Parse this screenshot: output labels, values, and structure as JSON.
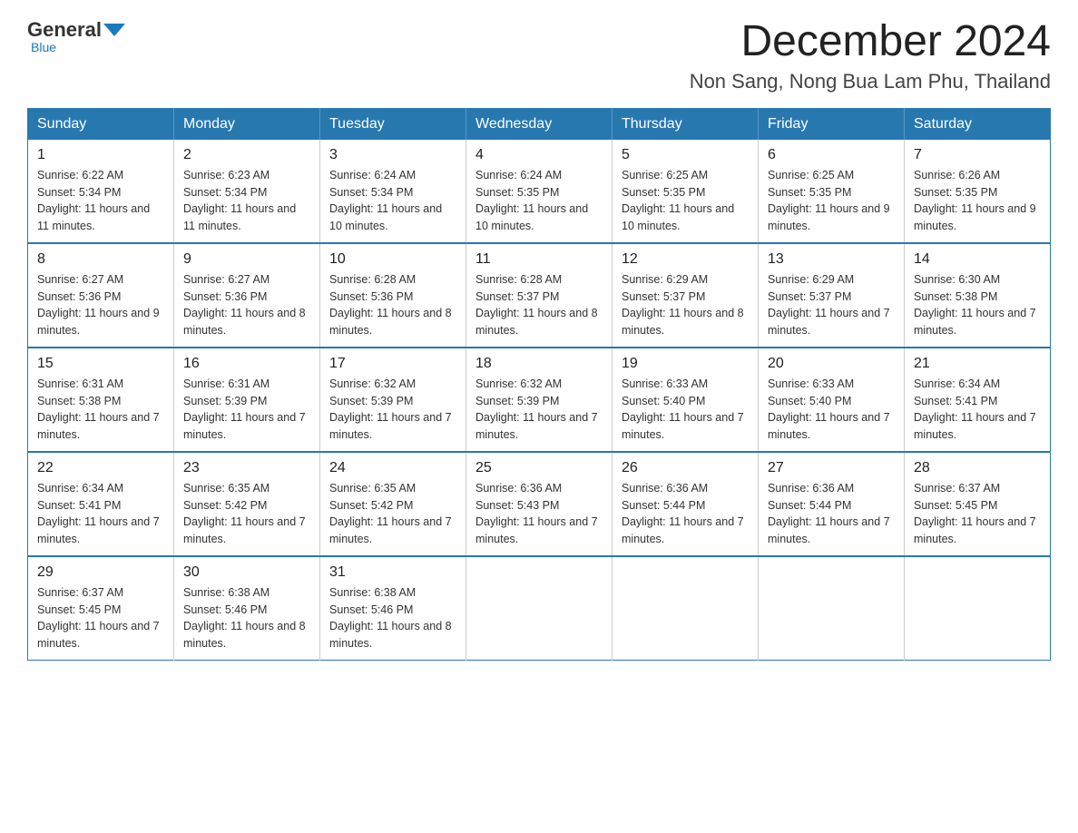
{
  "logo": {
    "general": "General",
    "blue": "Blue"
  },
  "title": "December 2024",
  "location": "Non Sang, Nong Bua Lam Phu, Thailand",
  "days_of_week": [
    "Sunday",
    "Monday",
    "Tuesday",
    "Wednesday",
    "Thursday",
    "Friday",
    "Saturday"
  ],
  "weeks": [
    [
      {
        "day": "1",
        "sunrise": "6:22 AM",
        "sunset": "5:34 PM",
        "daylight": "11 hours and 11 minutes."
      },
      {
        "day": "2",
        "sunrise": "6:23 AM",
        "sunset": "5:34 PM",
        "daylight": "11 hours and 11 minutes."
      },
      {
        "day": "3",
        "sunrise": "6:24 AM",
        "sunset": "5:34 PM",
        "daylight": "11 hours and 10 minutes."
      },
      {
        "day": "4",
        "sunrise": "6:24 AM",
        "sunset": "5:35 PM",
        "daylight": "11 hours and 10 minutes."
      },
      {
        "day": "5",
        "sunrise": "6:25 AM",
        "sunset": "5:35 PM",
        "daylight": "11 hours and 10 minutes."
      },
      {
        "day": "6",
        "sunrise": "6:25 AM",
        "sunset": "5:35 PM",
        "daylight": "11 hours and 9 minutes."
      },
      {
        "day": "7",
        "sunrise": "6:26 AM",
        "sunset": "5:35 PM",
        "daylight": "11 hours and 9 minutes."
      }
    ],
    [
      {
        "day": "8",
        "sunrise": "6:27 AM",
        "sunset": "5:36 PM",
        "daylight": "11 hours and 9 minutes."
      },
      {
        "day": "9",
        "sunrise": "6:27 AM",
        "sunset": "5:36 PM",
        "daylight": "11 hours and 8 minutes."
      },
      {
        "day": "10",
        "sunrise": "6:28 AM",
        "sunset": "5:36 PM",
        "daylight": "11 hours and 8 minutes."
      },
      {
        "day": "11",
        "sunrise": "6:28 AM",
        "sunset": "5:37 PM",
        "daylight": "11 hours and 8 minutes."
      },
      {
        "day": "12",
        "sunrise": "6:29 AM",
        "sunset": "5:37 PM",
        "daylight": "11 hours and 8 minutes."
      },
      {
        "day": "13",
        "sunrise": "6:29 AM",
        "sunset": "5:37 PM",
        "daylight": "11 hours and 7 minutes."
      },
      {
        "day": "14",
        "sunrise": "6:30 AM",
        "sunset": "5:38 PM",
        "daylight": "11 hours and 7 minutes."
      }
    ],
    [
      {
        "day": "15",
        "sunrise": "6:31 AM",
        "sunset": "5:38 PM",
        "daylight": "11 hours and 7 minutes."
      },
      {
        "day": "16",
        "sunrise": "6:31 AM",
        "sunset": "5:39 PM",
        "daylight": "11 hours and 7 minutes."
      },
      {
        "day": "17",
        "sunrise": "6:32 AM",
        "sunset": "5:39 PM",
        "daylight": "11 hours and 7 minutes."
      },
      {
        "day": "18",
        "sunrise": "6:32 AM",
        "sunset": "5:39 PM",
        "daylight": "11 hours and 7 minutes."
      },
      {
        "day": "19",
        "sunrise": "6:33 AM",
        "sunset": "5:40 PM",
        "daylight": "11 hours and 7 minutes."
      },
      {
        "day": "20",
        "sunrise": "6:33 AM",
        "sunset": "5:40 PM",
        "daylight": "11 hours and 7 minutes."
      },
      {
        "day": "21",
        "sunrise": "6:34 AM",
        "sunset": "5:41 PM",
        "daylight": "11 hours and 7 minutes."
      }
    ],
    [
      {
        "day": "22",
        "sunrise": "6:34 AM",
        "sunset": "5:41 PM",
        "daylight": "11 hours and 7 minutes."
      },
      {
        "day": "23",
        "sunrise": "6:35 AM",
        "sunset": "5:42 PM",
        "daylight": "11 hours and 7 minutes."
      },
      {
        "day": "24",
        "sunrise": "6:35 AM",
        "sunset": "5:42 PM",
        "daylight": "11 hours and 7 minutes."
      },
      {
        "day": "25",
        "sunrise": "6:36 AM",
        "sunset": "5:43 PM",
        "daylight": "11 hours and 7 minutes."
      },
      {
        "day": "26",
        "sunrise": "6:36 AM",
        "sunset": "5:44 PM",
        "daylight": "11 hours and 7 minutes."
      },
      {
        "day": "27",
        "sunrise": "6:36 AM",
        "sunset": "5:44 PM",
        "daylight": "11 hours and 7 minutes."
      },
      {
        "day": "28",
        "sunrise": "6:37 AM",
        "sunset": "5:45 PM",
        "daylight": "11 hours and 7 minutes."
      }
    ],
    [
      {
        "day": "29",
        "sunrise": "6:37 AM",
        "sunset": "5:45 PM",
        "daylight": "11 hours and 7 minutes."
      },
      {
        "day": "30",
        "sunrise": "6:38 AM",
        "sunset": "5:46 PM",
        "daylight": "11 hours and 8 minutes."
      },
      {
        "day": "31",
        "sunrise": "6:38 AM",
        "sunset": "5:46 PM",
        "daylight": "11 hours and 8 minutes."
      },
      null,
      null,
      null,
      null
    ]
  ],
  "labels": {
    "sunrise": "Sunrise: ",
    "sunset": "Sunset: ",
    "daylight": "Daylight: "
  }
}
